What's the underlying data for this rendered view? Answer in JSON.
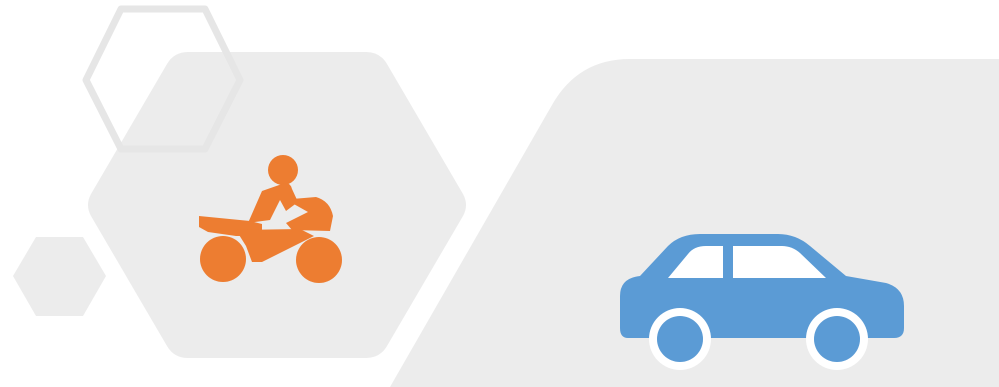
{
  "colors": {
    "background": "#ffffff",
    "panel_fill": "#ececec",
    "outline_stroke": "#e6e6e6",
    "motorcycle": "#ed7d31",
    "car": "#5b9bd5",
    "car_window": "#ffffff"
  },
  "icons": {
    "left": "motorcycle-rider-icon",
    "right": "car-icon"
  }
}
